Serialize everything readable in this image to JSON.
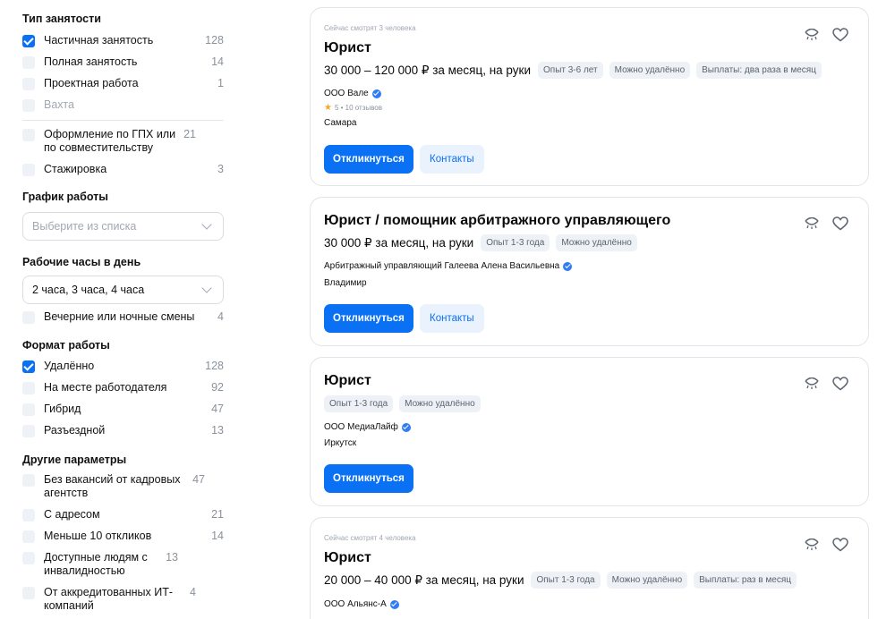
{
  "filters": {
    "employment": {
      "title": "Тип занятости",
      "options": [
        {
          "label": "Частичная занятость",
          "count": "128",
          "checked": true
        },
        {
          "label": "Полная занятость",
          "count": "14",
          "checked": false
        },
        {
          "label": "Проектная работа",
          "count": "1",
          "checked": false
        },
        {
          "label": "Вахта",
          "count": "",
          "checked": false,
          "disabled": true
        }
      ],
      "options_extra": [
        {
          "label": "Оформление по ГПХ или по совместительству",
          "count": "21",
          "checked": false
        },
        {
          "label": "Стажировка",
          "count": "3",
          "checked": false
        }
      ]
    },
    "schedule": {
      "title": "График работы",
      "placeholder": "Выберите из списка"
    },
    "hours": {
      "title": "Рабочие часы в день",
      "value": "2 часа, 3 часа, 4 часа",
      "evening": {
        "label": "Вечерние или ночные смены",
        "count": "4",
        "checked": false
      }
    },
    "format": {
      "title": "Формат работы",
      "options": [
        {
          "label": "Удалённо",
          "count": "128",
          "checked": true
        },
        {
          "label": "На месте работодателя",
          "count": "92",
          "checked": false
        },
        {
          "label": "Гибрид",
          "count": "47",
          "checked": false
        },
        {
          "label": "Разъездной",
          "count": "13",
          "checked": false
        }
      ]
    },
    "other": {
      "title": "Другие параметры",
      "options": [
        {
          "label": "Без вакансий от кадровых агентств",
          "count": "47",
          "checked": false
        },
        {
          "label": "С адресом",
          "count": "21",
          "checked": false
        },
        {
          "label": "Меньше 10 откликов",
          "count": "14",
          "checked": false
        },
        {
          "label": "Доступные людям с инвалидностью",
          "count": "13",
          "checked": false
        },
        {
          "label": "От аккредитованных ИТ-компаний",
          "count": "4",
          "checked": false
        }
      ]
    }
  },
  "vacancies": [
    {
      "watchers": "Сейчас смотрят 3 человека",
      "title": "Юрист",
      "salary": "30 000 – 120 000 ₽ за месяц, на руки",
      "tags": [
        "Опыт 3-6 лет",
        "Можно удалённо",
        "Выплаты: два раза в месяц"
      ],
      "company": "ООО Вале",
      "rating": "5 • 10 отзывов",
      "city": "Самара",
      "respond": "Откликнуться",
      "contacts": "Контакты"
    },
    {
      "title": "Юрист / помощник арбитражного управляющего",
      "salary": "30 000 ₽ за месяц, на руки",
      "tags": [
        "Опыт 1-3 года",
        "Можно удалённо"
      ],
      "company": "Арбитражный управляющий Галеева Алена Васильевна",
      "city": "Владимир",
      "respond": "Откликнуться",
      "contacts": "Контакты"
    },
    {
      "title": "Юрист",
      "tags": [
        "Опыт 1-3 года",
        "Можно удалённо"
      ],
      "company": "ООО МедиаЛайф",
      "city": "Иркутск",
      "respond": "Откликнуться"
    },
    {
      "watchers": "Сейчас смотрят 4 человека",
      "title": "Юрист",
      "salary": "20 000 – 40 000 ₽ за месяц, на руки",
      "tags": [
        "Опыт 1-3 года",
        "Можно удалённо",
        "Выплаты: раз в месяц"
      ],
      "company": "ООО Альянс-А"
    }
  ],
  "icons": {
    "hide": "eye-closed-icon",
    "favorite": "heart-icon",
    "verified": "verified-check-icon",
    "star": "star-icon"
  },
  "colors": {
    "accent": "#0a71f5",
    "accent_light": "#eaf2fe",
    "tag_bg": "#eef1f5"
  }
}
